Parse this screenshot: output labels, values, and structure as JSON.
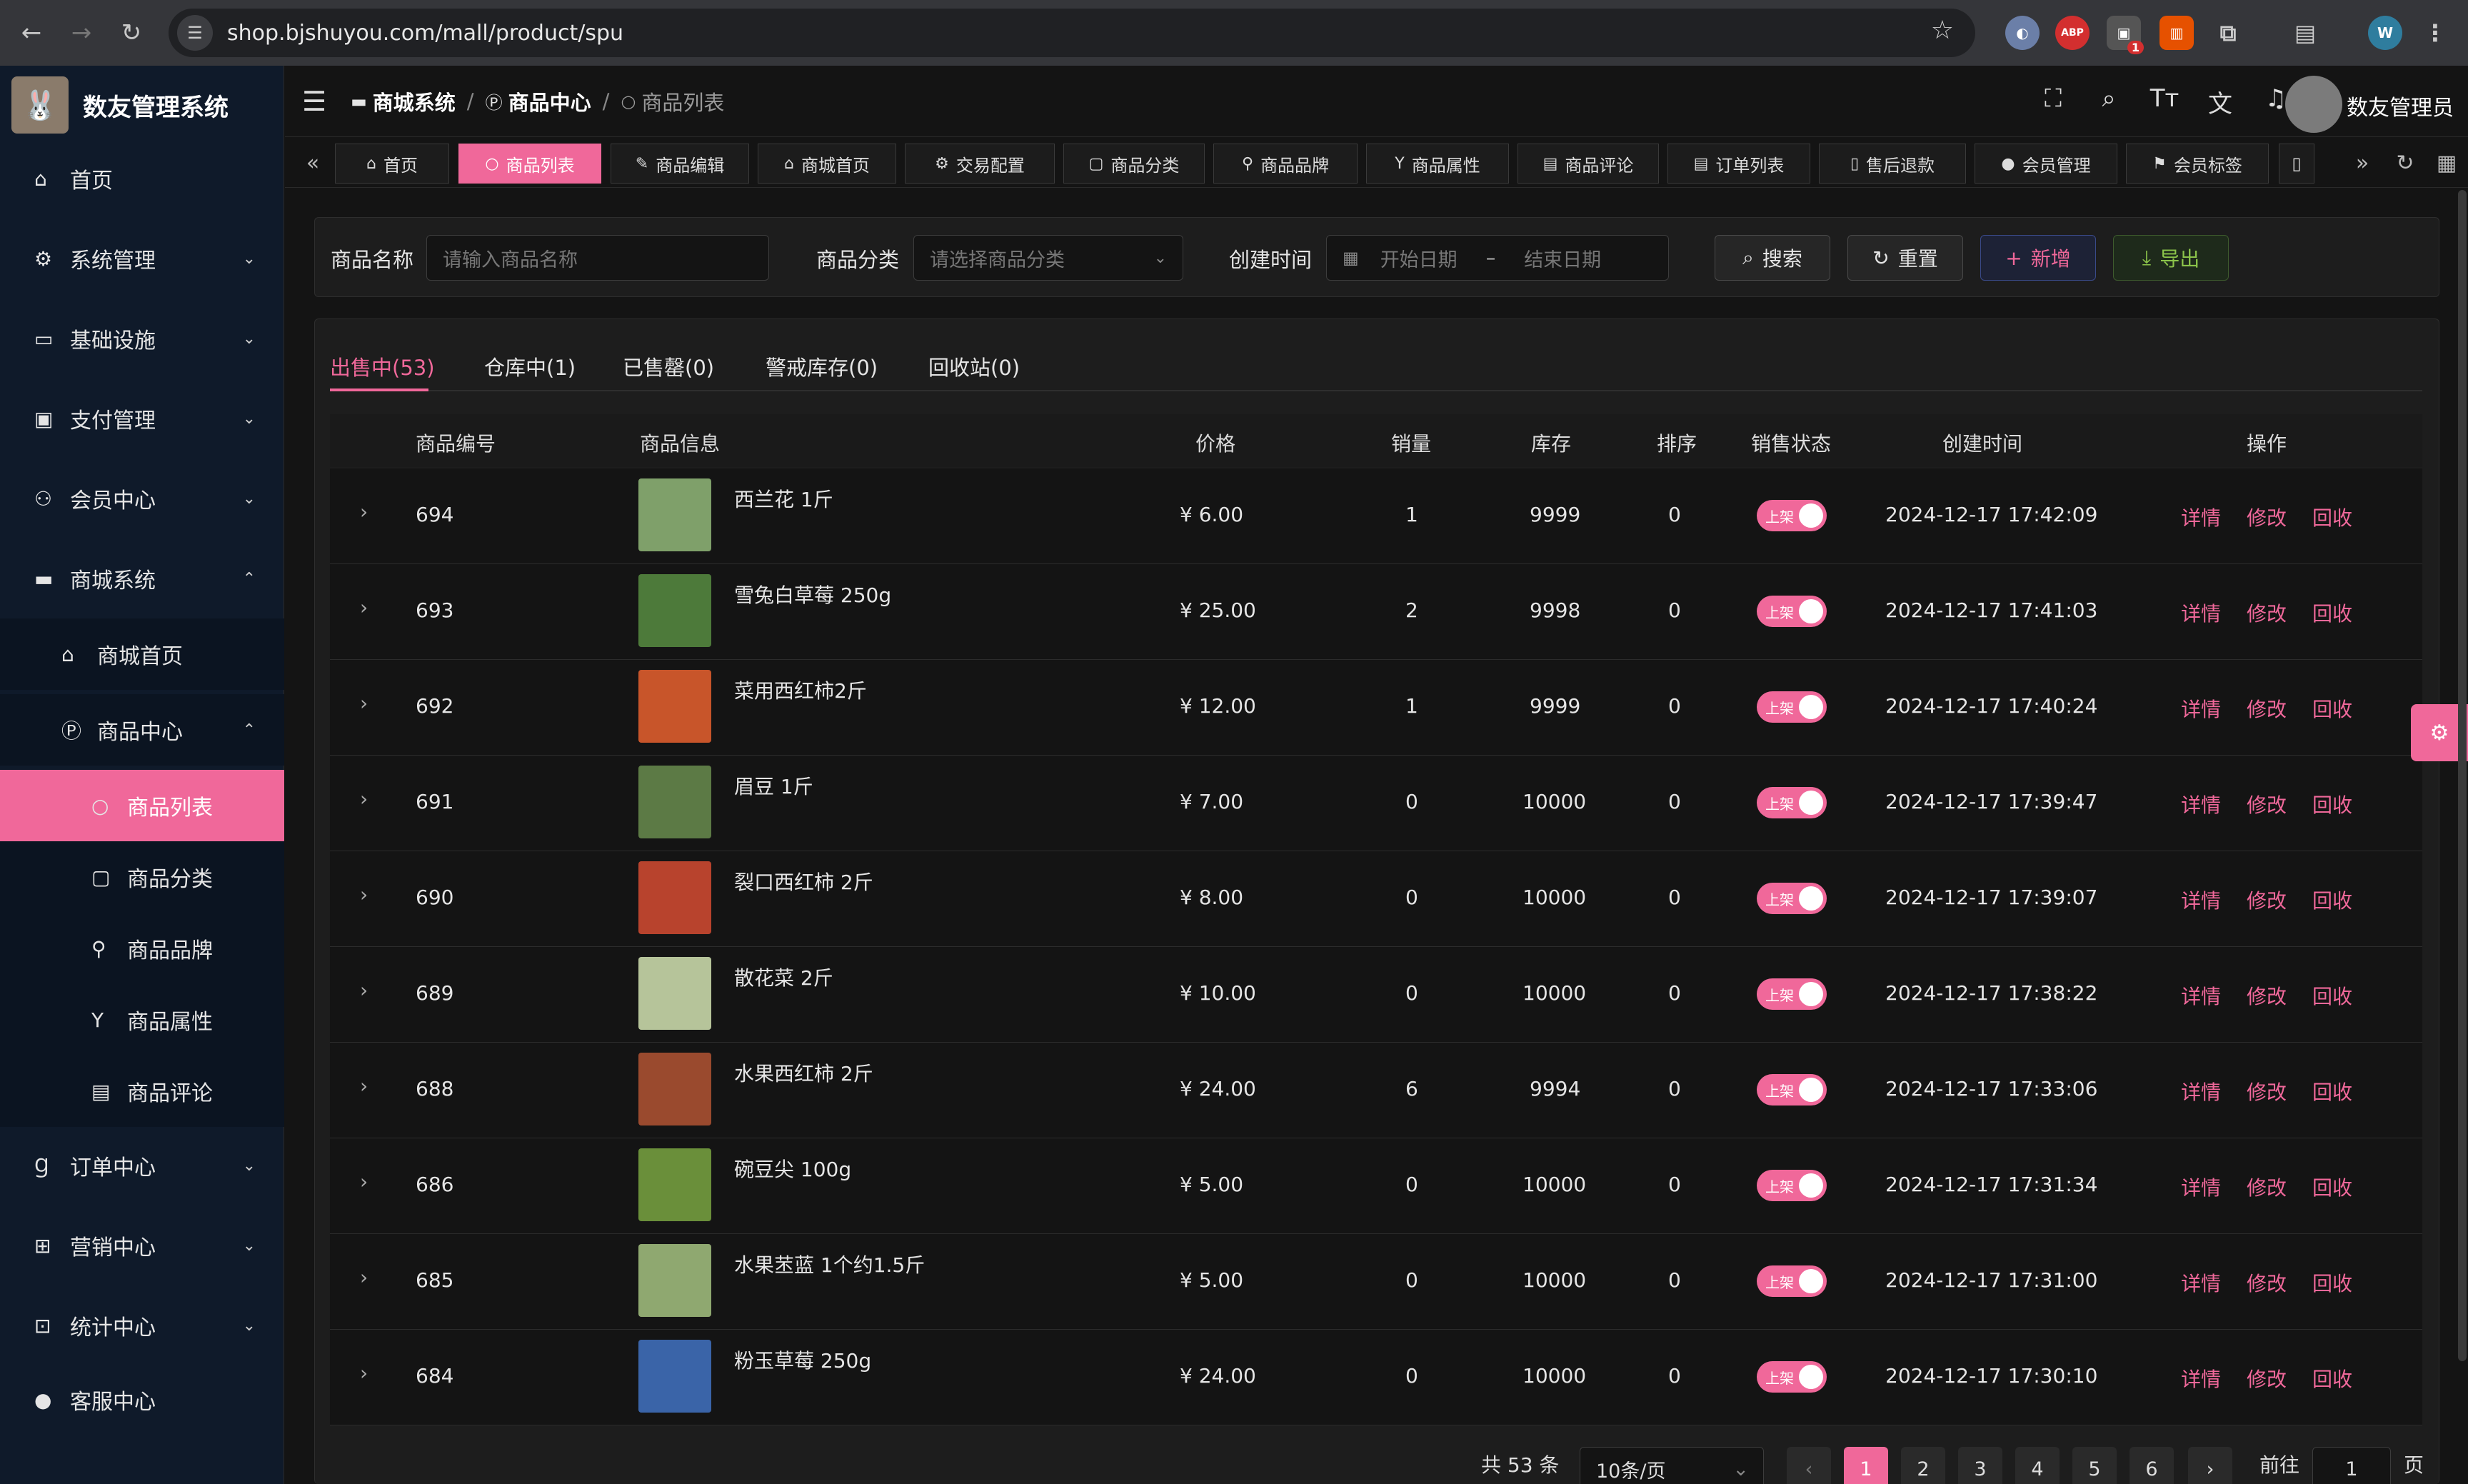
{
  "browser": {
    "url": "shop.bjshuyou.com/mall/product/spu",
    "ext_abp": "ABP",
    "ext_badge": "1",
    "profile_initial": "W"
  },
  "sidebar": {
    "brand": "数友管理系统",
    "items": [
      {
        "label": "首页",
        "icon": "home-icon",
        "glyph": "⌂"
      },
      {
        "label": "系统管理",
        "icon": "gear-icon",
        "glyph": "⚙"
      },
      {
        "label": "基础设施",
        "icon": "monitor-icon",
        "glyph": "▭"
      },
      {
        "label": "支付管理",
        "icon": "payment-icon",
        "glyph": "▣"
      },
      {
        "label": "会员中心",
        "icon": "members-icon",
        "glyph": "⚇"
      },
      {
        "label": "商城系统",
        "icon": "shop-icon",
        "glyph": "▬"
      },
      {
        "label": "商城首页",
        "icon": "home-icon",
        "glyph": "⌂"
      },
      {
        "label": "商品中心",
        "icon": "product-icon",
        "glyph": "Ⓟ"
      },
      {
        "label": "商品列表",
        "icon": "apple-icon",
        "glyph": "○"
      },
      {
        "label": "商品分类",
        "icon": "category-icon",
        "glyph": "▢"
      },
      {
        "label": "商品品牌",
        "icon": "brand-icon",
        "glyph": "⚲"
      },
      {
        "label": "商品属性",
        "icon": "attribute-icon",
        "glyph": "Y"
      },
      {
        "label": "商品评论",
        "icon": "comment-icon",
        "glyph": "▤"
      },
      {
        "label": "订单中心",
        "icon": "order-icon",
        "glyph": "Ɡ"
      },
      {
        "label": "营销中心",
        "icon": "gift-icon",
        "glyph": "⊞"
      },
      {
        "label": "统计中心",
        "icon": "stats-icon",
        "glyph": "⊡"
      },
      {
        "label": "客服中心",
        "icon": "user-icon",
        "glyph": "●"
      }
    ]
  },
  "header": {
    "breadcrumb": [
      "商城系统",
      "商品中心",
      "商品列表"
    ],
    "username": "数友管理员"
  },
  "tags": [
    {
      "label": "首页",
      "glyph": "⌂"
    },
    {
      "label": "商品列表",
      "glyph": "○"
    },
    {
      "label": "商品编辑",
      "glyph": "✎"
    },
    {
      "label": "商城首页",
      "glyph": "⌂"
    },
    {
      "label": "交易配置",
      "glyph": "⚙"
    },
    {
      "label": "商品分类",
      "glyph": "▢"
    },
    {
      "label": "商品品牌",
      "glyph": "⚲"
    },
    {
      "label": "商品属性",
      "glyph": "Y"
    },
    {
      "label": "商品评论",
      "glyph": "▤"
    },
    {
      "label": "订单列表",
      "glyph": "▤"
    },
    {
      "label": "售后退款",
      "glyph": "▯"
    },
    {
      "label": "会员管理",
      "glyph": "●"
    },
    {
      "label": "会员标签",
      "glyph": "⚑"
    }
  ],
  "search": {
    "name_label": "商品名称",
    "name_placeholder": "请输入商品名称",
    "category_label": "商品分类",
    "category_placeholder": "请选择商品分类",
    "time_label": "创建时间",
    "start_placeholder": "开始日期",
    "range_sep": "–",
    "end_placeholder": "结束日期",
    "search_btn": "搜索",
    "reset_btn": "重置",
    "add_btn": "新增",
    "export_btn": "导出"
  },
  "tabs": [
    "出售中(53)",
    "仓库中(1)",
    "已售罄(0)",
    "警戒库存(0)",
    "回收站(0)"
  ],
  "table": {
    "headers": [
      "商品编号",
      "商品信息",
      "价格",
      "销量",
      "库存",
      "排序",
      "销售状态",
      "创建时间",
      "操作"
    ],
    "status_label": "上架",
    "actions": [
      "详情",
      "修改",
      "回收"
    ],
    "rows": [
      {
        "id": "694",
        "name": "西兰花 1斤",
        "price": "¥ 6.00",
        "sales": "1",
        "stock": "9999",
        "sort": "0",
        "created": "2024-12-17 17:42:09",
        "color": "#7fa06a"
      },
      {
        "id": "693",
        "name": "雪兔白草莓 250g",
        "price": "¥ 25.00",
        "sales": "2",
        "stock": "9998",
        "sort": "0",
        "created": "2024-12-17 17:41:03",
        "color": "#4d7a3a"
      },
      {
        "id": "692",
        "name": "菜用西红柿2斤",
        "price": "¥ 12.00",
        "sales": "1",
        "stock": "9999",
        "sort": "0",
        "created": "2024-12-17 17:40:24",
        "color": "#c8552a"
      },
      {
        "id": "691",
        "name": "眉豆 1斤",
        "price": "¥ 7.00",
        "sales": "0",
        "stock": "10000",
        "sort": "0",
        "created": "2024-12-17 17:39:47",
        "color": "#5c7a45"
      },
      {
        "id": "690",
        "name": "裂口西红柿 2斤",
        "price": "¥ 8.00",
        "sales": "0",
        "stock": "10000",
        "sort": "0",
        "created": "2024-12-17 17:39:07",
        "color": "#b8432d"
      },
      {
        "id": "689",
        "name": "散花菜 2斤",
        "price": "¥ 10.00",
        "sales": "0",
        "stock": "10000",
        "sort": "0",
        "created": "2024-12-17 17:38:22",
        "color": "#b6c49a"
      },
      {
        "id": "688",
        "name": "水果西红柿 2斤",
        "price": "¥ 24.00",
        "sales": "6",
        "stock": "9994",
        "sort": "0",
        "created": "2024-12-17 17:33:06",
        "color": "#9a4a2e"
      },
      {
        "id": "686",
        "name": "碗豆尖 100g",
        "price": "¥ 5.00",
        "sales": "0",
        "stock": "10000",
        "sort": "0",
        "created": "2024-12-17 17:31:34",
        "color": "#6a8f3a"
      },
      {
        "id": "685",
        "name": "水果苤蓝 1个约1.5斤",
        "price": "¥ 5.00",
        "sales": "0",
        "stock": "10000",
        "sort": "0",
        "created": "2024-12-17 17:31:00",
        "color": "#8fa870"
      },
      {
        "id": "684",
        "name": "粉玉草莓 250g",
        "price": "¥ 24.00",
        "sales": "0",
        "stock": "10000",
        "sort": "0",
        "created": "2024-12-17 17:30:10",
        "color": "#3a64a8"
      }
    ]
  },
  "pagination": {
    "total": "共 53 条",
    "page_size": "10条/页",
    "pages": [
      "1",
      "2",
      "3",
      "4",
      "5",
      "6"
    ],
    "goto_label": "前往",
    "goto_value": "1",
    "page_suffix": "页"
  },
  "colors": {
    "accent": "#f0689a",
    "sidebar_bg": "#0f1a2a",
    "page_bg": "#141414"
  }
}
